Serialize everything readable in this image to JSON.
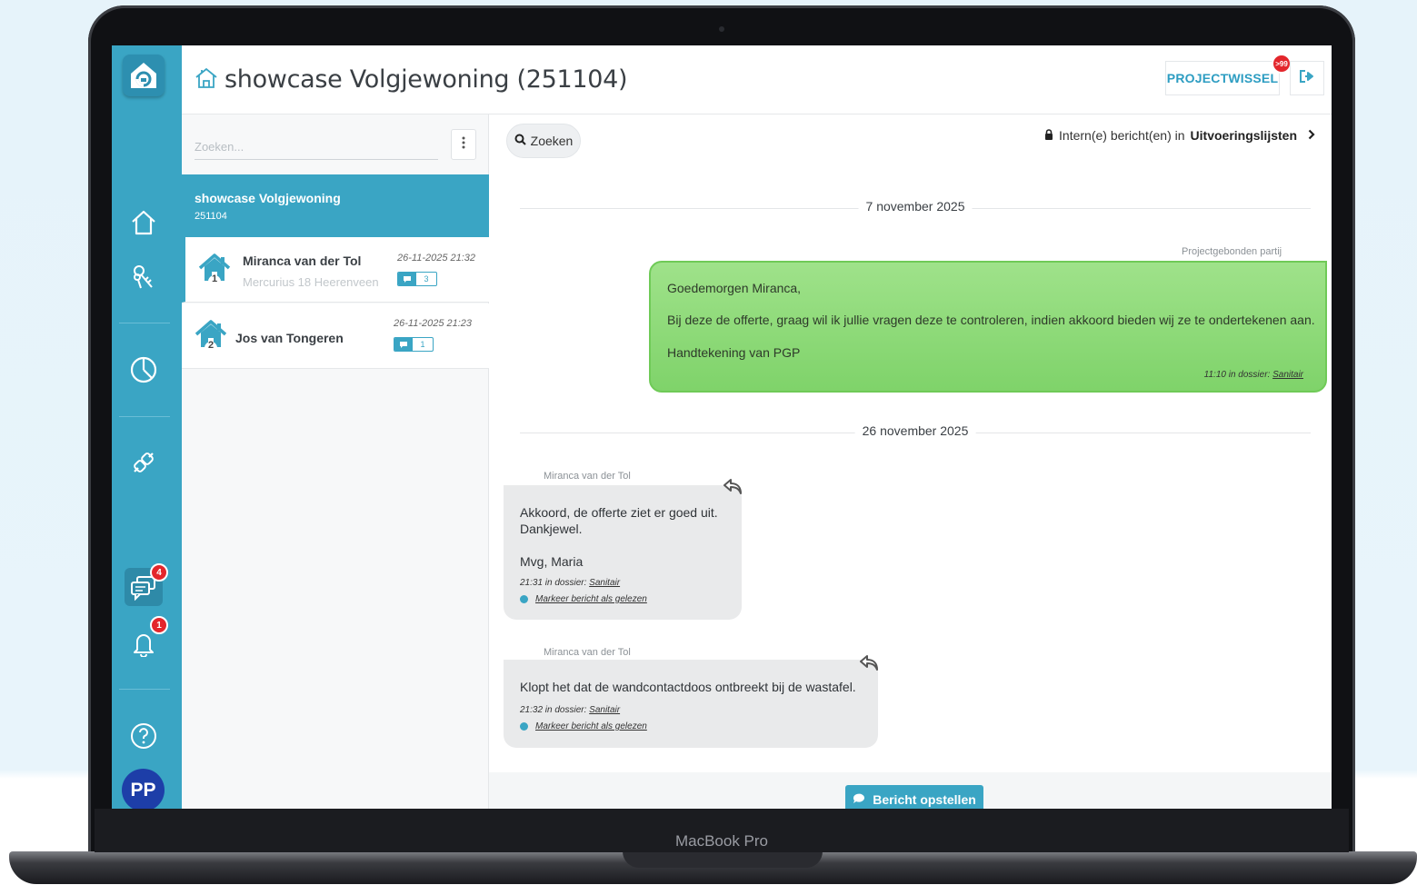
{
  "device": {
    "label": "MacBook Pro"
  },
  "header": {
    "title": "showcase Volgjewoning (251104)",
    "projectwissel_label": "PROJECTWISSEL",
    "projectwissel_badge": ">99"
  },
  "sidebar": {
    "chat_badge": "4",
    "notification_badge": "1",
    "avatar_initials": "PP"
  },
  "threads": {
    "search_placeholder": "Zoeken...",
    "project": {
      "name": "showcase Volgjewoning",
      "number": "251104"
    },
    "items": [
      {
        "house_number": "1",
        "name": "Miranca van der Tol",
        "address": "Mercurius 18 Heerenveen",
        "date": "26-11-2025 21:32",
        "count": "3"
      },
      {
        "house_number": "2",
        "name": "Jos van Tongeren",
        "address": "",
        "date": "26-11-2025 21:23",
        "count": "1"
      }
    ]
  },
  "conversation": {
    "search_label": "Zoeken",
    "intern_prefix": "Intern(e) bericht(en) in",
    "intern_target": "Uitvoeringslijsten",
    "date_1": "7 november 2025",
    "date_2": "26 november 2025",
    "outgoing": {
      "sender": "Projectgebonden partij",
      "line1": "Goedemorgen Miranca,",
      "line2": "Bij deze de offerte, graag wil ik jullie vragen deze te controleren, indien akkoord bieden wij ze te ondertekenen aan.",
      "line3": "Handtekening van PGP",
      "meta_prefix": "11:10 in dossier:",
      "meta_dossier": "Sanitair"
    },
    "incoming": [
      {
        "sender": "Miranca van der Tol",
        "line1": "Akkoord, de offerte ziet er goed uit.",
        "line2": "Dankjewel.",
        "line3": "Mvg, Maria",
        "meta_prefix": "21:31 in dossier:",
        "meta_dossier": "Sanitair",
        "mark_label": "Markeer bericht als gelezen"
      },
      {
        "sender": "Miranca van der Tol",
        "line1": "Klopt het dat de wandcontactdoos ontbreekt bij de wastafel.",
        "meta_prefix": "21:32 in dossier:",
        "meta_dossier": "Sanitair",
        "mark_label": "Markeer bericht als gelezen"
      }
    ],
    "compose_label": "Bericht opstellen"
  },
  "colors": {
    "accent": "#3aa5c4",
    "outgoing_bubble": "#8fdc78",
    "badge": "#e3262c",
    "avatar": "#1d3ea8"
  }
}
